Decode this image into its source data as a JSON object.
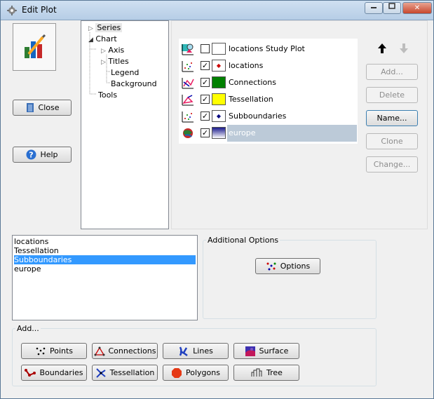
{
  "window": {
    "title": "Edit Plot",
    "titlebar_buttons": [
      "minimize",
      "maximize",
      "close"
    ]
  },
  "left_buttons": {
    "close_label": "Close",
    "help_label": "Help"
  },
  "tree": {
    "items": [
      {
        "label": "Series",
        "selected": true
      },
      {
        "label": "Chart"
      },
      {
        "label": "Axis"
      },
      {
        "label": "Titles"
      },
      {
        "label": "Legend"
      },
      {
        "label": "Background"
      },
      {
        "label": "Tools"
      }
    ]
  },
  "series": {
    "rows": [
      {
        "label": "locations Study Plot",
        "checked": false,
        "swatch": "#ffffff"
      },
      {
        "label": "locations",
        "checked": true,
        "swatch": "#cc0000"
      },
      {
        "label": "Connections",
        "checked": true,
        "swatch": "#008000"
      },
      {
        "label": "Tessellation",
        "checked": true,
        "swatch": "#ffff00"
      },
      {
        "label": "Subboundaries",
        "checked": true,
        "swatch": "#000080"
      },
      {
        "label": "europe",
        "checked": true,
        "swatch": "#1a1a8c",
        "selected": true
      }
    ]
  },
  "right_buttons": {
    "add": "Add...",
    "delete": "Delete",
    "name": "Name...",
    "clone": "Clone",
    "change": "Change..."
  },
  "bottom_list": {
    "items": [
      "locations",
      "Tessellation",
      "Subboundaries",
      "europe"
    ],
    "selected_index": 2
  },
  "additional_options": {
    "label": "Additional Options",
    "options_button": "Options"
  },
  "add_group": {
    "label": "Add...",
    "buttons": [
      "Points",
      "Connections",
      "Lines",
      "Surface",
      "Boundaries",
      "Tessellation",
      "Polygons",
      "Tree"
    ]
  }
}
